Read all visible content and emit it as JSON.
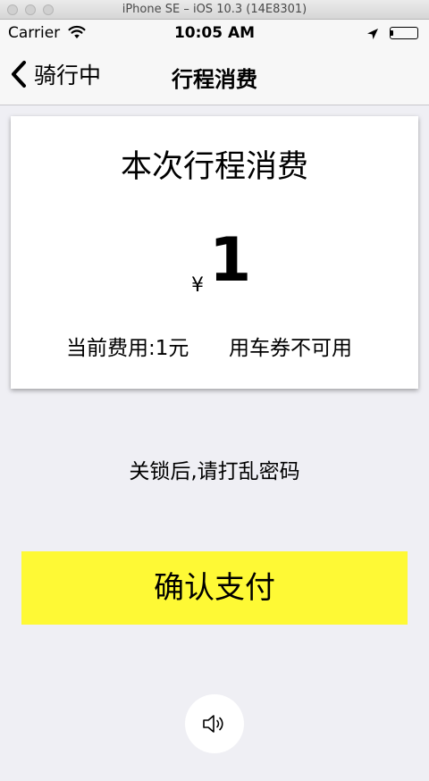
{
  "window": {
    "title": "iPhone SE – iOS 10.3 (14E8301)"
  },
  "status_bar": {
    "carrier": "Carrier",
    "time": "10:05 AM"
  },
  "nav": {
    "back_label": "骑行中",
    "title": "行程消费"
  },
  "card": {
    "title": "本次行程消费",
    "currency_symbol": "¥",
    "amount": "1",
    "fee_text": "当前费用:1元",
    "coupon_text": "用车券不可用"
  },
  "tip": "关锁后,请打乱密码",
  "confirm_label": "确认支付",
  "icons": {
    "back": "chevron-left-icon",
    "wifi": "wifi-icon",
    "location": "location-arrow-icon",
    "battery": "battery-icon",
    "speaker": "speaker-icon"
  },
  "colors": {
    "accent_button": "#fef935",
    "background": "#efeff4"
  }
}
